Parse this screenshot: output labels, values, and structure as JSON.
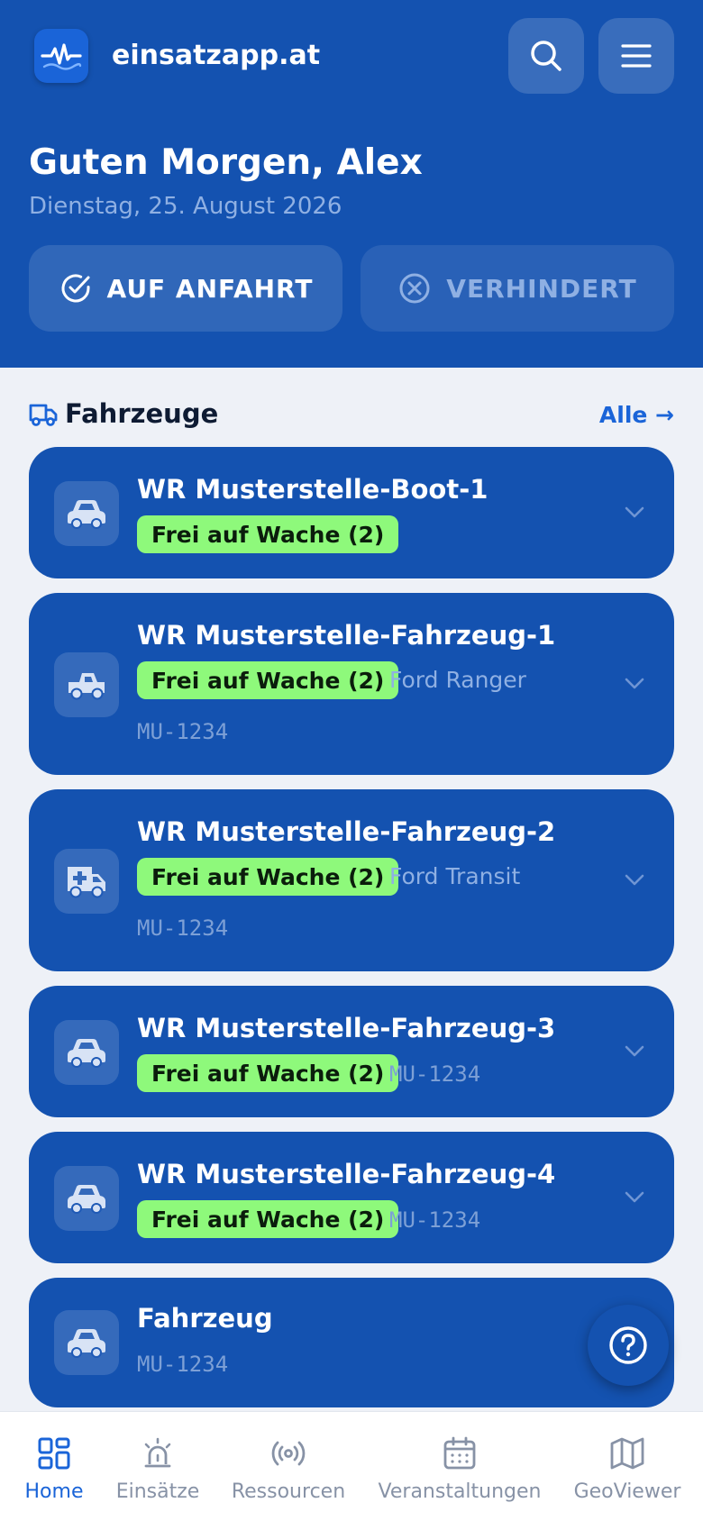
{
  "header": {
    "brand": "einsatzapp.at",
    "greeting": "Guten Morgen, Alex",
    "date": "Dienstag, 25. August 2026",
    "status_on_label": "AUF ANFAHRT",
    "status_off_label": "VERHINDERT",
    "search_icon": "search-icon",
    "menu_icon": "menu-icon"
  },
  "section": {
    "title": "Fahrzeuge",
    "link": "Alle →"
  },
  "vehicles": [
    {
      "name": "WR Musterstelle-Boot-1",
      "status": "Frei auf Wache (2)",
      "icon": "car-icon"
    },
    {
      "name": "WR Musterstelle-Fahrzeug-1",
      "status": "Frei auf Wache (2)",
      "model": "Ford Ranger",
      "plate": "MU-1234",
      "icon": "pickup-icon"
    },
    {
      "name": "WR Musterstelle-Fahrzeug-2",
      "status": "Frei auf Wache (2)",
      "model": "Ford Transit",
      "plate": "MU-1234",
      "icon": "ambulance-icon"
    },
    {
      "name": "WR Musterstelle-Fahrzeug-3",
      "status": "Frei auf Wache (2)",
      "plate": "MU-1234",
      "icon": "car-icon"
    },
    {
      "name": "WR Musterstelle-Fahrzeug-4",
      "status": "Frei auf Wache (2)",
      "plate": "MU-1234",
      "icon": "car-icon"
    },
    {
      "name": "Fahrzeug",
      "plate": "MU-1234",
      "icon": "car-icon"
    }
  ],
  "nav": {
    "items": [
      {
        "label": "Home",
        "icon": "home-grid-icon",
        "active": true
      },
      {
        "label": "Einsätze",
        "icon": "siren-icon"
      },
      {
        "label": "Ressourcen",
        "icon": "radio-icon"
      },
      {
        "label": "Veranstaltungen",
        "icon": "calendar-icon"
      },
      {
        "label": "GeoViewer",
        "icon": "map-icon"
      }
    ]
  },
  "colors": {
    "primary": "#1452b0",
    "accent": "#1a64d8",
    "badge": "#8ef97b",
    "background": "#eef1f7"
  }
}
